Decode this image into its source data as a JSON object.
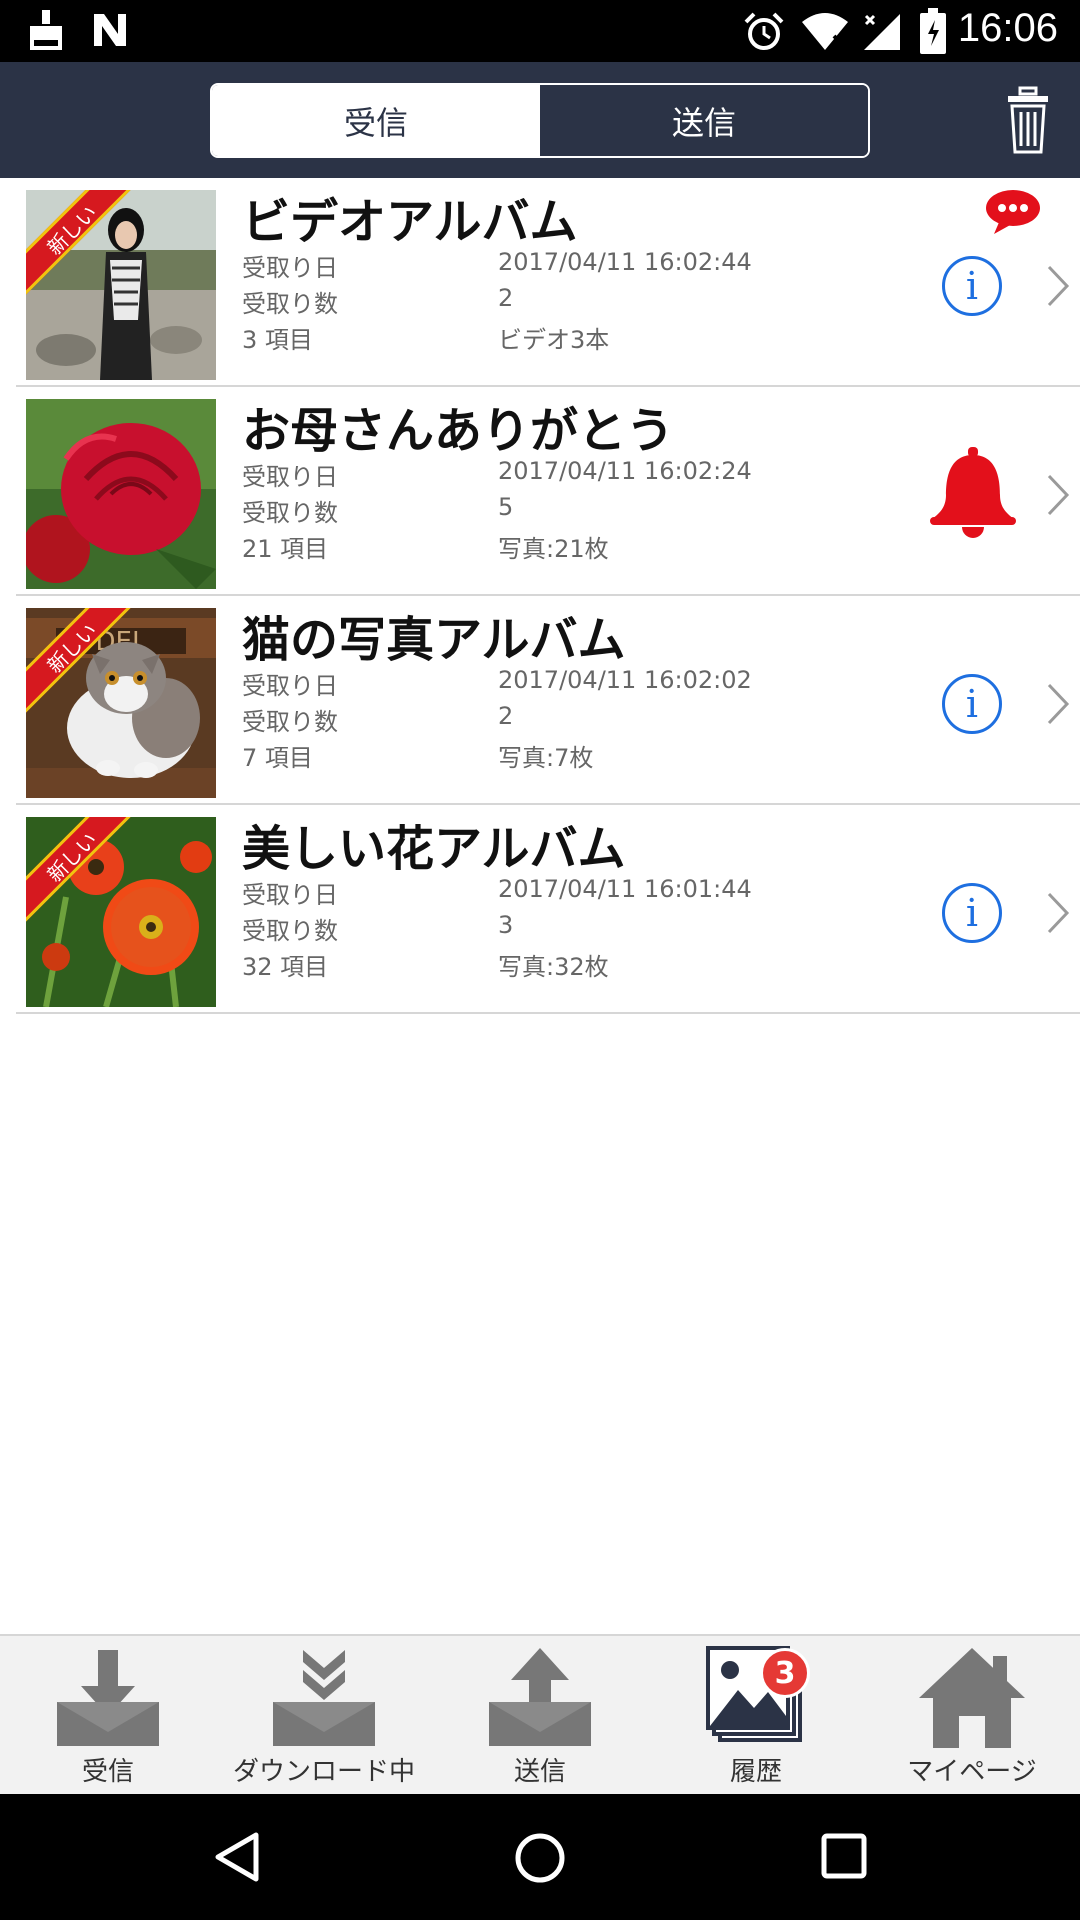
{
  "status_bar": {
    "time": "16:06"
  },
  "header": {
    "tabs": [
      {
        "label": "受信",
        "active": true
      },
      {
        "label": "送信",
        "active": false
      }
    ]
  },
  "list": {
    "items": [
      {
        "title": "ビデオアルバム",
        "new_badge": "新しい",
        "received_date_label": "受取り日",
        "received_date": "2017/04/11 16:02:44",
        "received_count_label": "受取り数",
        "received_count": "2",
        "items_count": "3 項目",
        "content": "ビデオ3本",
        "status_icon": "chat-bubble-icon",
        "action_icon": "info-icon"
      },
      {
        "title": "お母さんありがとう",
        "new_badge": "",
        "received_date_label": "受取り日",
        "received_date": "2017/04/11 16:02:24",
        "received_count_label": "受取り数",
        "received_count": "5",
        "items_count": "21 項目",
        "content": "写真:21枚",
        "action_icon": "bell-icon"
      },
      {
        "title": "猫の写真アルバム",
        "new_badge": "新しい",
        "received_date_label": "受取り日",
        "received_date": "2017/04/11 16:02:02",
        "received_count_label": "受取り数",
        "received_count": "2",
        "items_count": "7 項目",
        "content": "写真:7枚",
        "action_icon": "info-icon"
      },
      {
        "title": "美しい花アルバム",
        "new_badge": "新しい",
        "received_date_label": "受取り日",
        "received_date": "2017/04/11 16:01:44",
        "received_count_label": "受取り数",
        "received_count": "3",
        "items_count": "32 項目",
        "content": "写真:32枚",
        "action_icon": "info-icon"
      }
    ]
  },
  "bottom_nav": {
    "items": [
      {
        "label": "受信",
        "icon": "download-icon"
      },
      {
        "label": "ダウンロード中",
        "icon": "downloading-icon"
      },
      {
        "label": "送信",
        "icon": "upload-icon"
      },
      {
        "label": "履歴",
        "icon": "gallery-icon",
        "badge": "3"
      },
      {
        "label": "マイページ",
        "icon": "home-icon"
      }
    ]
  },
  "colors": {
    "header_bg": "#2b3346",
    "accent_blue": "#1e6fe0",
    "alert_red": "#e3101b",
    "badge_red": "#e53935"
  }
}
